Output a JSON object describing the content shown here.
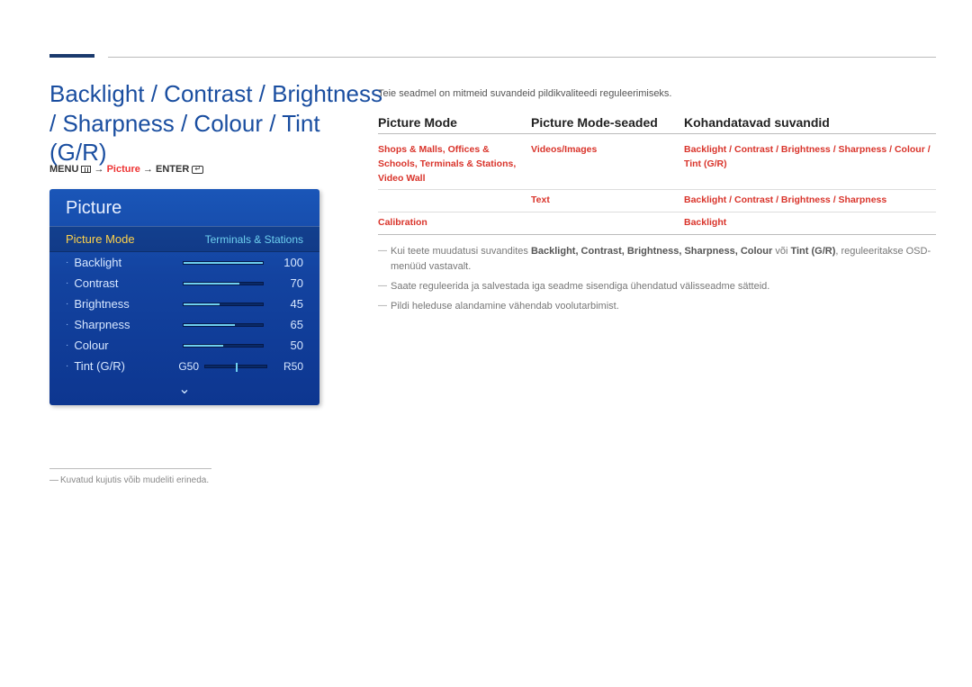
{
  "title": "Backlight / Contrast / Brightness / Sharpness / Colour / Tint (G/R)",
  "menu_path": {
    "menu": "MENU",
    "arrow": "→",
    "picture": "Picture",
    "enter": "ENTER"
  },
  "osd": {
    "title": "Picture",
    "mode_label": "Picture Mode",
    "mode_value": "Terminals & Stations",
    "items": [
      {
        "label": "Backlight",
        "value": "100",
        "fill": 100
      },
      {
        "label": "Contrast",
        "value": "70",
        "fill": 70
      },
      {
        "label": "Brightness",
        "value": "45",
        "fill": 45
      },
      {
        "label": "Sharpness",
        "value": "65",
        "fill": 65
      },
      {
        "label": "Colour",
        "value": "50",
        "fill": 50
      }
    ],
    "tint": {
      "label": "Tint (G/R)",
      "g": "G50",
      "r": "R50"
    }
  },
  "footnote": "Kuvatud kujutis võib mudeliti erineda.",
  "intro": "Teie seadmel on mitmeid suvandeid pildikvaliteedi reguleerimiseks.",
  "headers": {
    "h1": "Picture Mode",
    "h2": "Picture Mode-seaded",
    "h3": "Kohandatavad suvandid"
  },
  "rows": [
    {
      "c1": "Shops & Malls, Offices & Schools, Terminals & Stations, Video Wall",
      "c2": "Videos/Images",
      "c3": "Backlight / Contrast / Brightness / Sharpness / Colour / Tint (G/R)"
    },
    {
      "c1": "",
      "c2": "Text",
      "c3": "Backlight / Contrast / Brightness / Sharpness"
    },
    {
      "c1": "Calibration",
      "c2": "",
      "c3": "Backlight"
    }
  ],
  "notes": [
    {
      "pre": "Kui teete muudatusi suvandites ",
      "bold": "Backlight, Contrast, Brightness, Sharpness, Colour",
      "mid": " või ",
      "bold2": "Tint (G/R)",
      "post": ", reguleeritakse OSD-menüüd vastavalt."
    },
    {
      "text": "Saate reguleerida ja salvestada iga seadme sisendiga ühendatud välisseadme sätteid."
    },
    {
      "text": "Pildi heleduse alandamine vähendab voolutarbimist."
    }
  ]
}
